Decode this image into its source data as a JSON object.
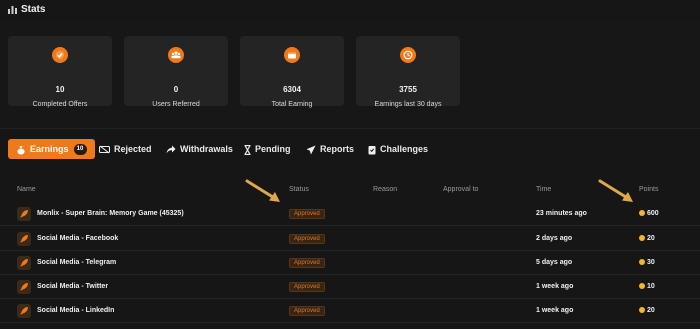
{
  "header": {
    "title": "Stats",
    "icon": "bar-chart-icon"
  },
  "stats": [
    {
      "value": "10",
      "label": "Completed Offers",
      "icon": "check-circle-icon"
    },
    {
      "value": "0",
      "label": "Users Referred",
      "icon": "users-icon"
    },
    {
      "value": "6304",
      "label": "Total Earning",
      "icon": "wallet-icon"
    },
    {
      "value": "3755",
      "label": "Earnings last 30 days",
      "icon": "clock-icon"
    }
  ],
  "tabs": [
    {
      "label": "Earnings",
      "badge": "10",
      "icon": "money-bag-icon",
      "active": true
    },
    {
      "label": "Rejected",
      "icon": "rejected-icon"
    },
    {
      "label": "Withdrawals",
      "icon": "share-arrow-icon"
    },
    {
      "label": "Pending",
      "icon": "hourglass-icon"
    },
    {
      "label": "Reports",
      "icon": "send-icon"
    },
    {
      "label": "Challenges",
      "icon": "challenge-icon"
    }
  ],
  "table": {
    "columns": [
      "Name",
      "Status",
      "Reason",
      "Approval to",
      "Time",
      "Points"
    ],
    "rows": [
      {
        "name": "Monlix - Super Brain: Memory Game (45325)",
        "status": "Approved",
        "time": "23 minutes ago",
        "points": "600"
      },
      {
        "name": "Social Media - Facebook",
        "status": "Approved",
        "time": "2 days ago",
        "points": "20"
      },
      {
        "name": "Social Media - Telegram",
        "status": "Approved",
        "time": "5 days ago",
        "points": "30"
      },
      {
        "name": "Social Media - Twitter",
        "status": "Approved",
        "time": "1 week ago",
        "points": "10"
      },
      {
        "name": "Social Media - LinkedIn",
        "status": "Approved",
        "time": "1 week ago",
        "points": "20"
      }
    ]
  },
  "colors": {
    "accent": "#f07a1a",
    "background": "#161616",
    "card": "#242424",
    "coin": "#f2b62a",
    "annotation_arrow": "#e0a84a"
  }
}
